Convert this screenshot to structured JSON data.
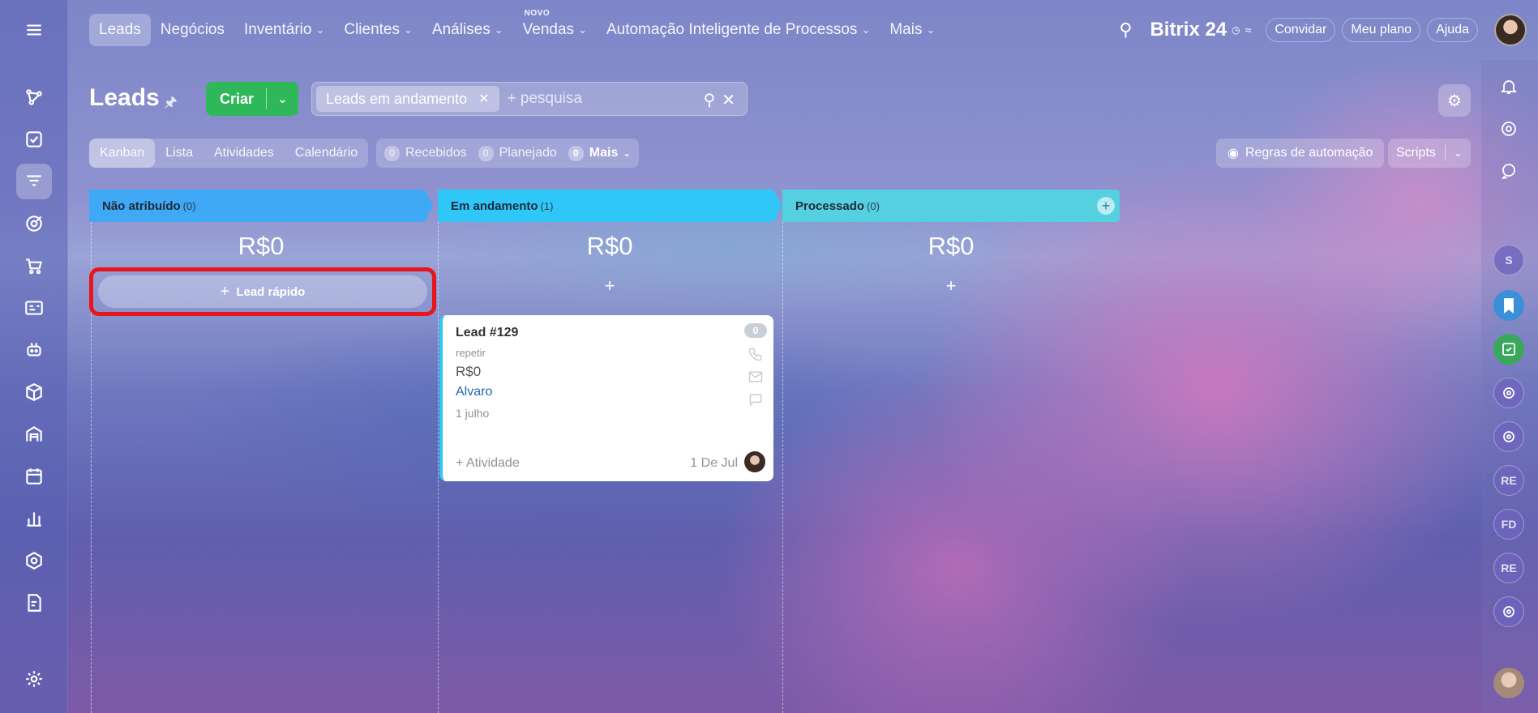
{
  "topnav": {
    "items": [
      {
        "label": "Leads",
        "active": true,
        "dropdown": false,
        "badge": ""
      },
      {
        "label": "Negócios",
        "active": false,
        "dropdown": false,
        "badge": ""
      },
      {
        "label": "Inventário",
        "active": false,
        "dropdown": true,
        "badge": ""
      },
      {
        "label": "Clientes",
        "active": false,
        "dropdown": true,
        "badge": ""
      },
      {
        "label": "Análises",
        "active": false,
        "dropdown": true,
        "badge": ""
      },
      {
        "label": "Vendas",
        "active": false,
        "dropdown": true,
        "badge": "NOVO"
      },
      {
        "label": "Automação Inteligente de Processos",
        "active": false,
        "dropdown": true,
        "badge": ""
      },
      {
        "label": "Mais",
        "active": false,
        "dropdown": true,
        "badge": ""
      }
    ],
    "brand": "Bitrix 24",
    "invite": "Convidar",
    "plan": "Meu plano",
    "help": "Ajuda"
  },
  "header": {
    "title": "Leads",
    "create_label": "Criar",
    "filter_chip": "Leads em andamento",
    "search_placeholder": "+ pesquisa"
  },
  "views": {
    "items": [
      "Kanban",
      "Lista",
      "Atividades",
      "Calendário"
    ],
    "active": "Kanban"
  },
  "counters": {
    "received_count": "0",
    "received_label": "Recebidos",
    "planned_count": "0",
    "planned_label": "Planejado",
    "more_count": "0",
    "more_label": "Mais"
  },
  "toolbar": {
    "automation_rules": "Regras de automação",
    "scripts": "Scripts"
  },
  "kanban": {
    "columns": [
      {
        "name": "Não atribuído",
        "count": "(0)",
        "sum": "R$0",
        "color": "#3fa9f5"
      },
      {
        "name": "Em andamento",
        "count": "(1)",
        "sum": "R$0",
        "color": "#2fc7f7"
      },
      {
        "name": "Processado",
        "count": "(0)",
        "sum": "R$0",
        "color": "#55d0e0"
      }
    ],
    "quick_lead": "Lead rápido",
    "add_symbol": "+"
  },
  "card": {
    "title": "Lead #129",
    "subtitle": "repetir",
    "amount": "R$0",
    "responsible": "Alvaro",
    "date": "1 julho",
    "activity": "+ Atividade",
    "activity_date": "1 De Jul",
    "counter": "0"
  },
  "rightbar": {
    "avatars": [
      "S",
      "RE",
      "FD",
      "RE"
    ]
  },
  "colors": {
    "accent_green": "#2fb859",
    "highlight_red": "#e8151b",
    "link_blue": "#2067b0"
  }
}
